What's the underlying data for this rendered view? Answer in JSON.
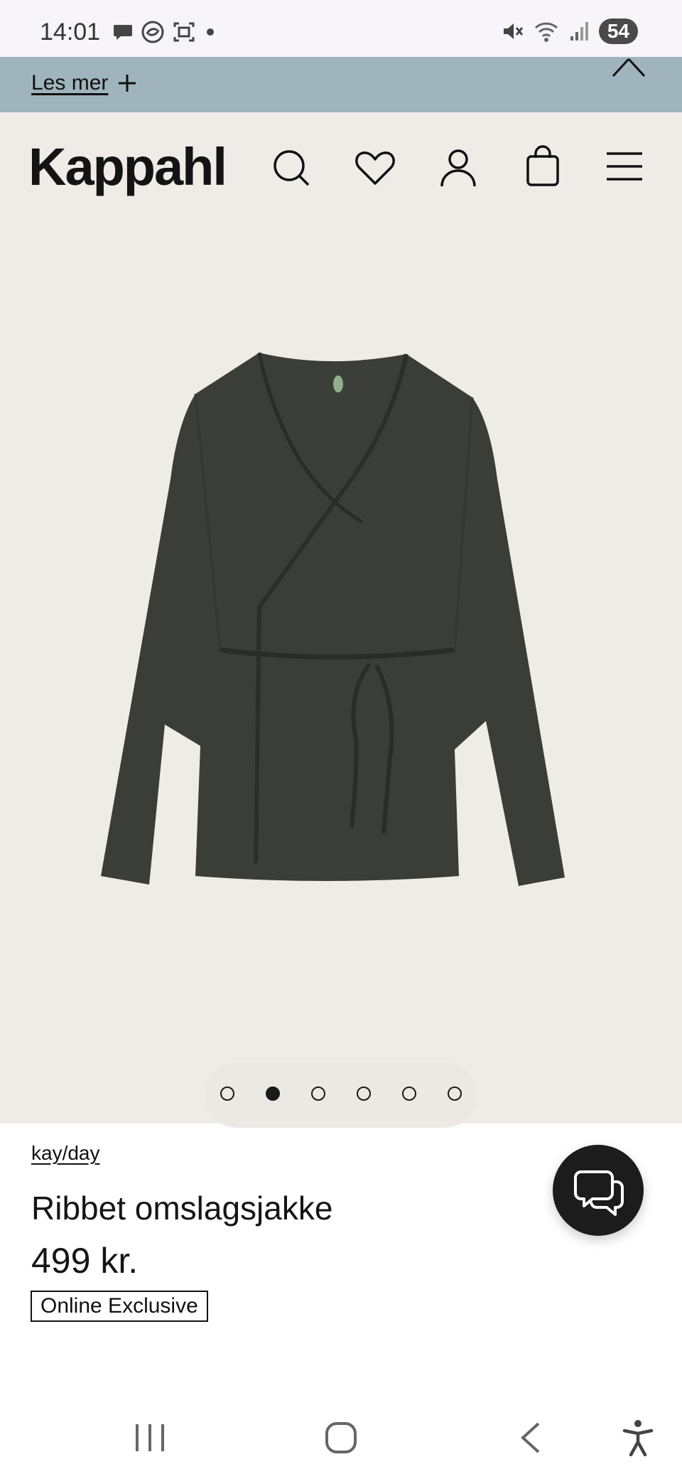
{
  "status_bar": {
    "time": "14:01",
    "battery": "54",
    "icons": [
      "chat-bubble-icon",
      "sync-icon",
      "screenshot-icon",
      "dot-icon",
      "mute-icon",
      "wifi-icon",
      "signal-icon"
    ]
  },
  "promo": {
    "link_text": "Les mer",
    "icons": [
      "plus-icon",
      "close-icon"
    ]
  },
  "header": {
    "logo": "Kappahl",
    "icons": [
      "search-icon",
      "heart-icon",
      "user-icon",
      "bag-icon",
      "menu-icon"
    ]
  },
  "gallery": {
    "image_count": 6,
    "active_index": 1
  },
  "product": {
    "brand": "kay/day",
    "name": "Ribbet omslagsjakke",
    "price": "499 kr.",
    "badge": "Online Exclusive"
  },
  "colors": {
    "promo_bg": "#9fb4bc",
    "page_bg": "#efece7",
    "garment": "#3b3d39",
    "chat_button": "#1c1c1c"
  },
  "nav": {
    "icons": [
      "recents-icon",
      "home-icon",
      "back-icon",
      "accessibility-icon"
    ]
  }
}
